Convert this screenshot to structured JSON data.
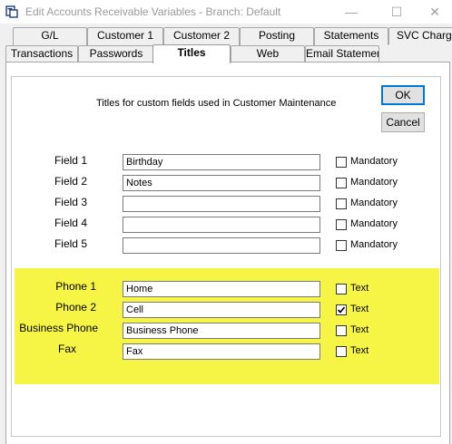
{
  "window": {
    "title": "Edit Accounts Receivable Variables  - Branch: Default",
    "minimize": "—",
    "maximize": "☐",
    "close": "✕"
  },
  "tabs_row1": [
    {
      "label": "G/L"
    },
    {
      "label": "Customer 1"
    },
    {
      "label": "Customer 2"
    },
    {
      "label": "Posting"
    },
    {
      "label": "Statements"
    },
    {
      "label": "SVC Charge"
    }
  ],
  "tabs_row2": [
    {
      "label": "Transactions"
    },
    {
      "label": "Passwords"
    },
    {
      "label": "Titles",
      "active": true
    },
    {
      "label": "Web"
    },
    {
      "label": "Email Statement"
    }
  ],
  "caption": "Titles for custom fields used in Customer Maintenance",
  "buttons": {
    "ok": "OK",
    "cancel": "Cancel"
  },
  "fields": [
    {
      "label": "Field 1",
      "value": "Birthday",
      "check_label": "Mandatory",
      "checked": false
    },
    {
      "label": "Field 2",
      "value": "Notes",
      "check_label": "Mandatory",
      "checked": false
    },
    {
      "label": "Field 3",
      "value": "",
      "check_label": "Mandatory",
      "checked": false
    },
    {
      "label": "Field 4",
      "value": "",
      "check_label": "Mandatory",
      "checked": false
    },
    {
      "label": "Field 5",
      "value": "",
      "check_label": "Mandatory",
      "checked": false
    }
  ],
  "phones": [
    {
      "label": "Phone 1",
      "value": "Home",
      "check_label": "Text",
      "checked": false
    },
    {
      "label": "Phone 2",
      "value": "Cell",
      "check_label": "Text",
      "checked": true
    },
    {
      "label": "Business Phone",
      "value": "Business Phone",
      "check_label": "Text",
      "checked": false
    },
    {
      "label": "Fax",
      "value": "Fax",
      "check_label": "Text",
      "checked": false
    }
  ],
  "colors": {
    "highlight": "#f6f545",
    "focus_border": "#0078d7"
  }
}
